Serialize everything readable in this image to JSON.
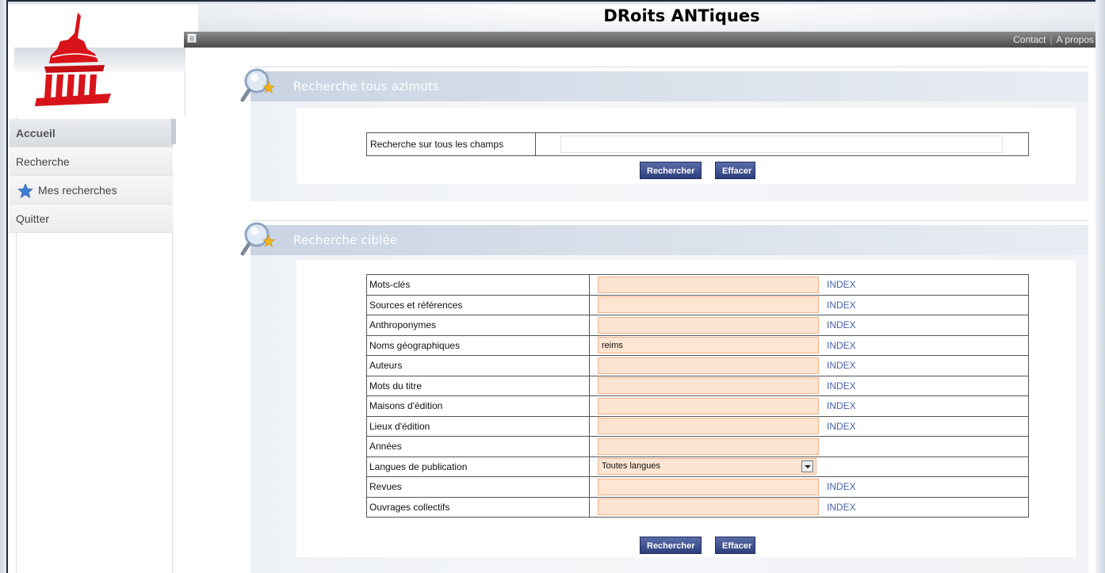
{
  "header": {
    "site_title": "DRoits ANTiques",
    "links": [
      "Contact",
      "A propos"
    ]
  },
  "nav": {
    "items": [
      {
        "label": "Accueil",
        "active": true
      },
      {
        "label": "Recherche",
        "active": false
      },
      {
        "label": "Mes recherches",
        "active": false,
        "icon": "star-icon"
      },
      {
        "label": "Quitter",
        "active": false
      }
    ]
  },
  "global_search": {
    "title": "Recherche tous azimuts",
    "field_label": "Recherche sur tous les champs",
    "field_value": "",
    "search_button": "Rechercher",
    "clear_button": "Effacer"
  },
  "targeted_search": {
    "title": "Recherche ciblée",
    "rows": [
      {
        "label": "Mots-clés",
        "value": "",
        "index": "INDEX"
      },
      {
        "label": "Sources et références",
        "value": "",
        "index": "INDEX"
      },
      {
        "label": "Anthroponymes",
        "value": "",
        "index": "INDEX"
      },
      {
        "label": "Noms géographiques",
        "value": "reims",
        "index": "INDEX"
      },
      {
        "label": "Auteurs",
        "value": "",
        "index": "INDEX"
      },
      {
        "label": "Mots du titre",
        "value": "",
        "index": "INDEX"
      },
      {
        "label": "Maisons d'édition",
        "value": "",
        "index": "INDEX"
      },
      {
        "label": "Lieux d'édition",
        "value": "",
        "index": "INDEX"
      },
      {
        "label": "Années",
        "value": "",
        "index": ""
      },
      {
        "label": "Langues de publication",
        "value": "Toutes langues",
        "index": "",
        "type": "select"
      },
      {
        "label": "Revues",
        "value": "",
        "index": "INDEX"
      },
      {
        "label": "Ouvrages collectifs",
        "value": "",
        "index": "INDEX"
      }
    ],
    "search_button": "Rechercher",
    "clear_button": "Effacer"
  },
  "colors": {
    "accent_button": "#2c3e7c",
    "field_bg": "#fde5d2",
    "field_border": "#f0b188",
    "index_link": "#4661a8",
    "logo_red": "#d8141a"
  }
}
